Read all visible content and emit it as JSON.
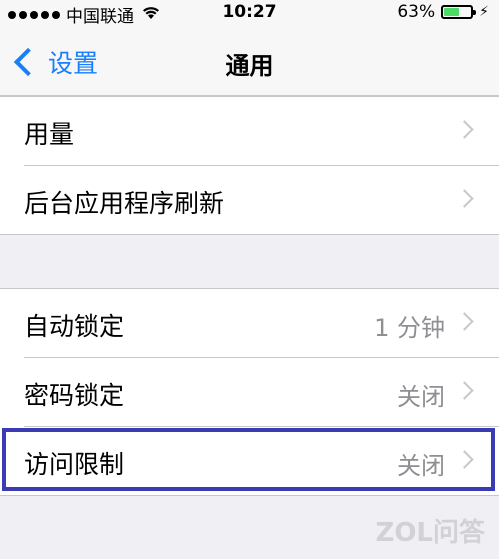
{
  "status_bar": {
    "carrier": "中国联通",
    "time": "10:27",
    "battery_percent": "63%",
    "battery_level": 0.63,
    "signal_icon": "signal-dots-icon",
    "wifi_icon": "wifi-icon",
    "charging_icon": "charging-bolt-icon"
  },
  "nav": {
    "back_label": "设置",
    "title": "通用",
    "accent_color": "#1a7efb"
  },
  "group1": [
    {
      "label": "用量",
      "value": ""
    },
    {
      "label": "后台应用程序刷新",
      "value": ""
    }
  ],
  "group2": [
    {
      "label": "自动锁定",
      "value": "1 分钟"
    },
    {
      "label": "密码锁定",
      "value": "关闭"
    },
    {
      "label": "访问限制",
      "value": "关闭"
    }
  ],
  "watermark": "ZOL问答",
  "highlight_color": "#3b3bb3"
}
